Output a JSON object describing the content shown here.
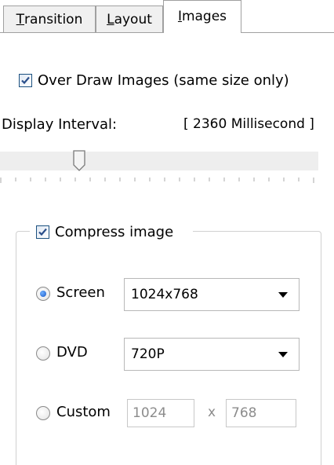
{
  "tabs": [
    {
      "pre": "",
      "ul": "T",
      "post": "ransition",
      "active": false
    },
    {
      "pre": "",
      "ul": "L",
      "post": "ayout",
      "active": false
    },
    {
      "pre": "",
      "ul": "I",
      "post": "mages",
      "active": true
    }
  ],
  "over_draw": {
    "label": "Over Draw Images (same size only)",
    "checked": true
  },
  "display_interval": {
    "label": "Display Interval:",
    "value": "[ 2360 Millisecond ]"
  },
  "compress": {
    "label": "Compress image",
    "checked": true,
    "options": [
      {
        "label": "Screen",
        "selected": true,
        "combo_value": "1024x768"
      },
      {
        "label": "DVD",
        "selected": false,
        "combo_value": "720P"
      },
      {
        "label": "Custom",
        "selected": false,
        "width": "1024",
        "separator": "x",
        "height": "768"
      }
    ]
  },
  "colors": {
    "accent": "#1a58c8",
    "border": "#a0a0a0",
    "check": "#2a4e8a"
  }
}
